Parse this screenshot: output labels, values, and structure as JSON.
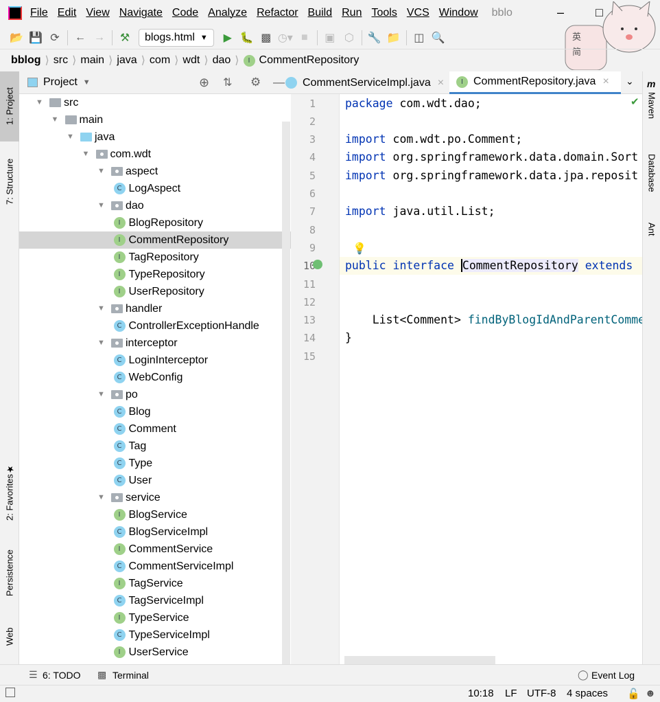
{
  "menubar": {
    "items": [
      "File",
      "Edit",
      "View",
      "Navigate",
      "Code",
      "Analyze",
      "Refactor",
      "Build",
      "Run",
      "Tools",
      "VCS",
      "Window"
    ],
    "title": "bblo"
  },
  "toolbar": {
    "run_config": "blogs.html"
  },
  "breadcrumb": [
    "bblog",
    "src",
    "main",
    "java",
    "com",
    "wdt",
    "dao",
    "CommentRepository"
  ],
  "left_stripe": {
    "project": "1: Project",
    "structure": "7: Structure",
    "favorites": "2: Favorites",
    "persistence": "Persistence",
    "web": "Web"
  },
  "project_panel": {
    "title": "Project"
  },
  "tree": [
    {
      "level": 1,
      "type": "folder",
      "label": "src"
    },
    {
      "level": 2,
      "type": "folder",
      "label": "main"
    },
    {
      "level": 3,
      "type": "src",
      "label": "java"
    },
    {
      "level": 4,
      "type": "pkg",
      "label": "com.wdt"
    },
    {
      "level": 5,
      "type": "pkg",
      "label": "aspect"
    },
    {
      "level": 6,
      "type": "C",
      "label": "LogAspect"
    },
    {
      "level": 5,
      "type": "pkg",
      "label": "dao"
    },
    {
      "level": 6,
      "type": "I",
      "label": "BlogRepository"
    },
    {
      "level": 6,
      "type": "I",
      "label": "CommentRepository",
      "selected": true
    },
    {
      "level": 6,
      "type": "I",
      "label": "TagRepository"
    },
    {
      "level": 6,
      "type": "I",
      "label": "TypeRepository"
    },
    {
      "level": 6,
      "type": "I",
      "label": "UserRepository"
    },
    {
      "level": 5,
      "type": "pkg",
      "label": "handler"
    },
    {
      "level": 6,
      "type": "C",
      "label": "ControllerExceptionHandle"
    },
    {
      "level": 5,
      "type": "pkg",
      "label": "interceptor"
    },
    {
      "level": 6,
      "type": "C",
      "label": "LoginInterceptor"
    },
    {
      "level": 6,
      "type": "C",
      "label": "WebConfig"
    },
    {
      "level": 5,
      "type": "pkg",
      "label": "po"
    },
    {
      "level": 6,
      "type": "C",
      "label": "Blog"
    },
    {
      "level": 6,
      "type": "C",
      "label": "Comment"
    },
    {
      "level": 6,
      "type": "C",
      "label": "Tag"
    },
    {
      "level": 6,
      "type": "C",
      "label": "Type"
    },
    {
      "level": 6,
      "type": "C",
      "label": "User"
    },
    {
      "level": 5,
      "type": "pkg",
      "label": "service"
    },
    {
      "level": 6,
      "type": "I",
      "label": "BlogService"
    },
    {
      "level": 6,
      "type": "C",
      "label": "BlogServiceImpl"
    },
    {
      "level": 6,
      "type": "I",
      "label": "CommentService"
    },
    {
      "level": 6,
      "type": "C",
      "label": "CommentServiceImpl"
    },
    {
      "level": 6,
      "type": "I",
      "label": "TagService"
    },
    {
      "level": 6,
      "type": "C",
      "label": "TagServiceImpl"
    },
    {
      "level": 6,
      "type": "I",
      "label": "TypeService"
    },
    {
      "level": 6,
      "type": "C",
      "label": "TypeServiceImpl"
    },
    {
      "level": 6,
      "type": "I",
      "label": "UserService"
    }
  ],
  "tabs": [
    {
      "label": "CommentServiceImpl.java",
      "active": false
    },
    {
      "label": "CommentRepository.java",
      "active": true
    }
  ],
  "code": [
    [
      {
        "t": "package",
        "c": "kw"
      },
      {
        "t": " com.wdt.dao;",
        "c": "id"
      }
    ],
    [],
    [
      {
        "t": "import",
        "c": "kw"
      },
      {
        "t": " com.wdt.po.Comment;",
        "c": "id"
      }
    ],
    [
      {
        "t": "import",
        "c": "kw"
      },
      {
        "t": " org.springframework.data.domain.Sort",
        "c": "id"
      }
    ],
    [
      {
        "t": "import",
        "c": "kw"
      },
      {
        "t": " org.springframework.data.jpa.reposit",
        "c": "id"
      }
    ],
    [],
    [
      {
        "t": "import",
        "c": "kw"
      },
      {
        "t": " java.util.List;",
        "c": "id"
      }
    ],
    [],
    [],
    [
      {
        "t": "public",
        "c": "kw"
      },
      {
        "t": " ",
        "c": "id"
      },
      {
        "t": "interface",
        "c": "kw"
      },
      {
        "t": " ",
        "c": "id"
      },
      {
        "t": "CommentRepository",
        "c": "id hl caret"
      },
      {
        "t": " ",
        "c": "id"
      },
      {
        "t": "extends",
        "c": "kw"
      }
    ],
    [],
    [],
    [
      {
        "t": "    List<Comment> ",
        "c": "id"
      },
      {
        "t": "findByBlogIdAndParentComme",
        "c": "fn"
      }
    ],
    [
      {
        "t": "}",
        "c": "id"
      }
    ],
    []
  ],
  "current_line": 10,
  "right_stripe": {
    "maven": "Maven",
    "database": "Database",
    "ant": "Ant"
  },
  "bottom_bar": {
    "todo": "6: TODO",
    "terminal": "Terminal",
    "event_log": "Event Log"
  },
  "status": {
    "position": "10:18",
    "line_sep": "LF",
    "encoding": "UTF-8",
    "indent": "4 spaces"
  },
  "mascot": {
    "chars": [
      "英",
      "简"
    ]
  },
  "colors": {
    "keyword": "#0033b3",
    "method": "#00627a",
    "selection": "#d5d5d5",
    "active_tab": "#4083c9"
  }
}
